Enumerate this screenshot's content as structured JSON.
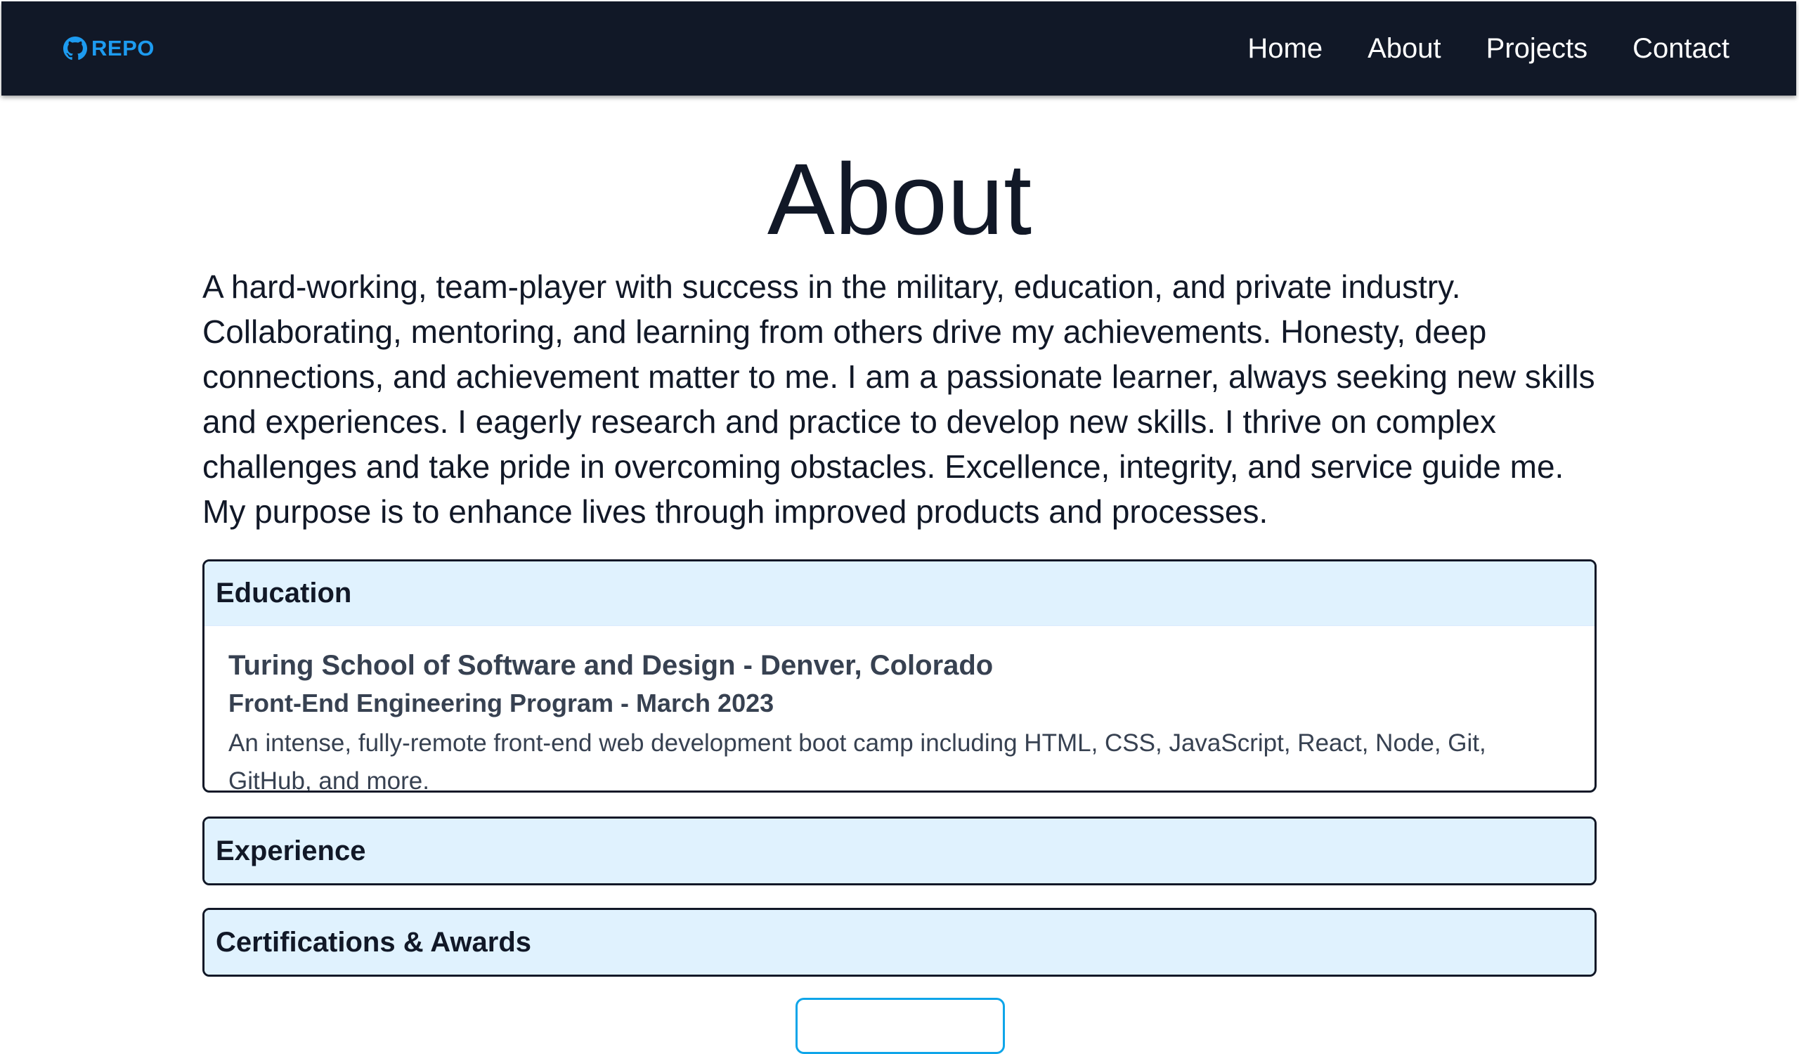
{
  "nav": {
    "brand": "REPO",
    "brand_icon": "github-icon",
    "brand_color": "#1d9bf0",
    "background": "#111827",
    "links": [
      "Home",
      "About",
      "Projects",
      "Contact"
    ]
  },
  "main": {
    "title": "About",
    "intro": "A hard-working, team-player with success in the military, education, and private industry. Collaborating, mentoring, and learning from others drive my achievements. Honesty, deep connections, and achievement matter to me. I am a passionate learner, always seeking new skills and experiences. I eagerly research and practice to develop new skills. I thrive on complex challenges and take pride in overcoming obstacles. Excellence, integrity, and service guide me. My purpose is to enhance lives through improved products and processes.",
    "sections": [
      {
        "title": "Education",
        "expanded": true,
        "school": "Turing School of Software and Design - Denver, Colorado",
        "program": "Front-End Engineering Program - March 2023",
        "description": "An intense, fully-remote front-end web development boot camp including HTML, CSS, JavaScript, React, Node, Git, GitHub, and more."
      },
      {
        "title": "Experience",
        "expanded": false
      },
      {
        "title": "Certifications & Awards",
        "expanded": false
      }
    ],
    "header_color": "#e0f2fe",
    "button_border_color": "#0ea5e9"
  }
}
